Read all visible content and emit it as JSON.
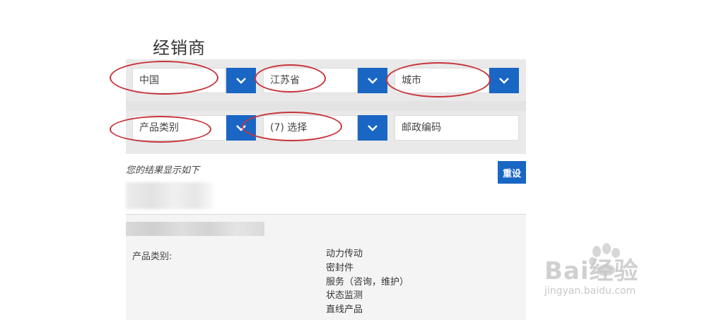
{
  "page": {
    "title": "经销商"
  },
  "filters": {
    "country": {
      "value": "中国"
    },
    "province": {
      "value": "江苏省"
    },
    "city": {
      "placeholder": "城市"
    },
    "product_category": {
      "placeholder": "产品类别"
    },
    "selection": {
      "value": "(7) 选择"
    },
    "postal_code": {
      "placeholder": "邮政编码"
    }
  },
  "results": {
    "heading": "您的结果显示如下",
    "reset_label": "重设",
    "category_label": "产品类别:",
    "categories": [
      "动力传动",
      "密封件",
      "服务（咨询，维护）",
      "状态监测",
      "直线产品"
    ]
  },
  "watermark": {
    "brand": "Bai经验",
    "url": "jingyan.baidu.com"
  },
  "colors": {
    "accent": "#1a66c4",
    "annotation": "#c8343a",
    "panel": "#e9e9e9"
  }
}
